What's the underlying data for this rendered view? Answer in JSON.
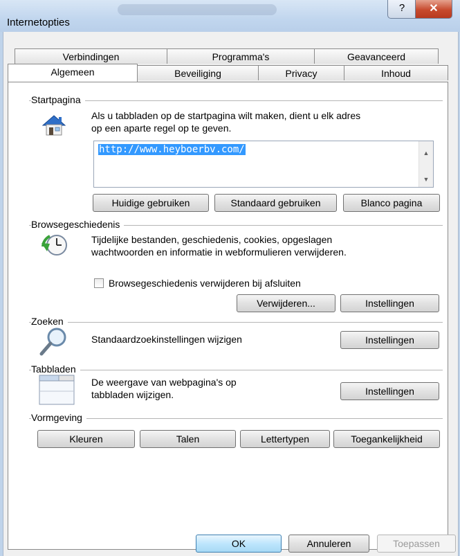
{
  "window": {
    "title": "Internetopties",
    "help_glyph": "?",
    "close_glyph": "✕"
  },
  "tabs": {
    "row1": [
      "Verbindingen",
      "Programma's",
      "Geavanceerd"
    ],
    "row2": [
      "Algemeen",
      "Beveiliging",
      "Privacy",
      "Inhoud"
    ],
    "active": "Algemeen"
  },
  "startpagina": {
    "label": "Startpagina",
    "text_line1": "Als u tabbladen op de startpagina wilt maken, dient u elk adres",
    "text_line2": "op een aparte regel op te geven.",
    "url": "http://www.heyboerbv.com/",
    "buttons": [
      "Huidige gebruiken",
      "Standaard gebruiken",
      "Blanco pagina"
    ]
  },
  "browsegeschiedenis": {
    "label": "Browsegeschiedenis",
    "text_line1": "Tijdelijke bestanden, geschiedenis, cookies, opgeslagen",
    "text_line2": "wachtwoorden en informatie in webformulieren verwijderen.",
    "checkbox_label": "Browsegeschiedenis verwijderen bij afsluiten",
    "checkbox_checked": false,
    "delete_button": "Verwijderen...",
    "settings_button": "Instellingen"
  },
  "zoeken": {
    "label": "Zoeken",
    "text": "Standaardzoekinstellingen wijzigen",
    "settings_button": "Instellingen"
  },
  "tabbladen": {
    "label": "Tabbladen",
    "text_line1": "De weergave van webpagina's op",
    "text_line2": "tabbladen wijzigen.",
    "settings_button": "Instellingen"
  },
  "vormgeving": {
    "label": "Vormgeving",
    "buttons": [
      "Kleuren",
      "Talen",
      "Lettertypen",
      "Toegankelijkheid"
    ]
  },
  "footer": {
    "ok": "OK",
    "cancel": "Annuleren",
    "apply": "Toepassen"
  }
}
